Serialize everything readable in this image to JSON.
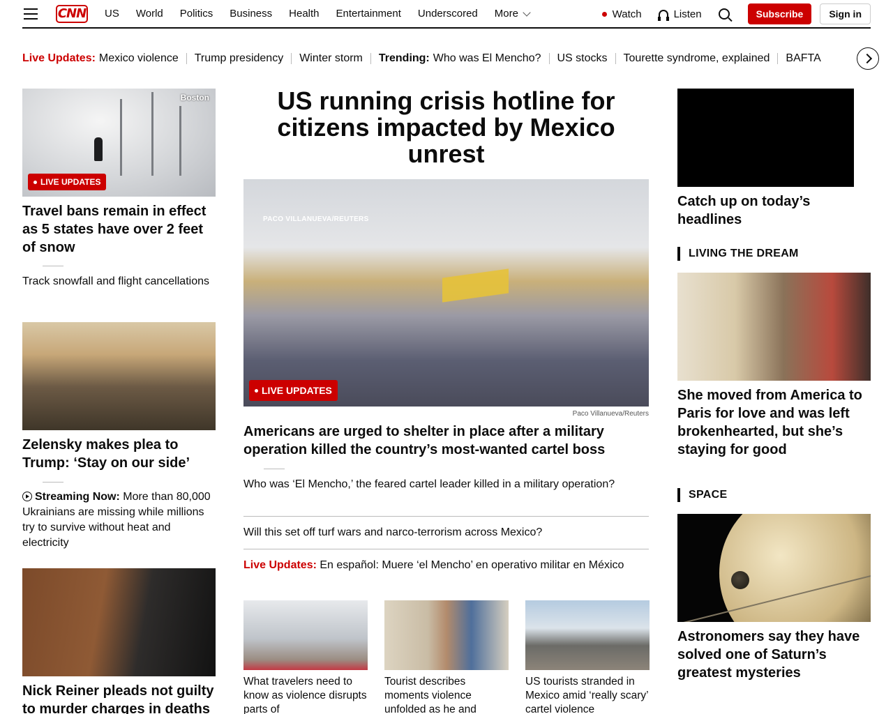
{
  "nav": {
    "logo": "CNN",
    "links": [
      "US",
      "World",
      "Politics",
      "Business",
      "Health",
      "Entertainment",
      "Underscored"
    ],
    "more": "More",
    "watch": "Watch",
    "listen": "Listen",
    "subscribe": "Subscribe",
    "signin": "Sign in"
  },
  "trending": {
    "live_label": "Live Updates:",
    "live_item": "Mexico violence",
    "items1": [
      "Trump presidency",
      "Winter storm"
    ],
    "trending_label": "Trending:",
    "trending_item": "Who was El Mencho?",
    "items2": [
      "US stocks",
      "Tourette syndrome, explained",
      "BAFTA"
    ]
  },
  "left": {
    "snow_tag": "Boston",
    "snow_badge": "LIVE UPDATES",
    "snow_headline": "Travel bans remain in effect as 5 states have over 2 feet of snow",
    "snow_sub": "Track snowfall and flight cancellations",
    "zel_headline": "Zelensky makes plea to Trump: ‘Stay on our side’",
    "stream_label": "Streaming Now:",
    "stream_text": "More than 80,000 Ukrainians are missing while millions try to survive without heat and electricity",
    "reiner_headline": "Nick Reiner pleads not guilty to murder charges in deaths"
  },
  "center": {
    "title": "US running crisis hotline for citizens impacted by Mexico unrest",
    "video_credit_overlay": "PACO VILLANUEVA/REUTERS",
    "video_badge": "LIVE UPDATES",
    "photo_credit": "Paco Villanueva/Reuters",
    "subhead": "Americans are urged to shelter in place after a military operation killed the country’s most-wanted cartel boss",
    "link1": "Who was ‘El Mencho,’ the feared cartel leader killed in a military operation?",
    "link2": "Will this set off turf wars and narco-terrorism across Mexico?",
    "live_label": "Live Updates:",
    "live_text": "En español: Muere ‘el Mencho’ en operativo militar en México",
    "cards": [
      {
        "text": "What travelers need to know as violence disrupts parts of"
      },
      {
        "text": "Tourist describes moments violence unfolded as he and"
      },
      {
        "text": "US tourists stranded in Mexico amid ‘really scary’ cartel violence"
      }
    ]
  },
  "right": {
    "video_caption": "Catch up on today’s headlines",
    "section1": "LIVING THE DREAM",
    "paris_headline": "She moved from America to Paris for love and was left brokenhearted, but she’s staying for good",
    "section2": "SPACE",
    "saturn_headline": "Astronomers say they have solved one of Saturn’s greatest mysteries"
  }
}
